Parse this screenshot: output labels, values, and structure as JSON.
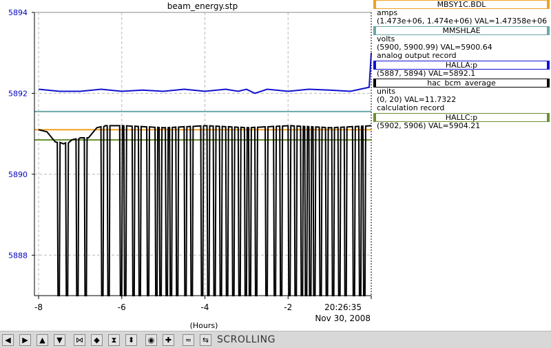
{
  "chart_data": {
    "type": "line",
    "title": "beam_energy.stp",
    "xlabel": "(Hours)",
    "xlim": [
      -8.1,
      0
    ],
    "ylim": [
      5887,
      5894
    ],
    "x_ticks": [
      -8,
      -6,
      -4,
      -2
    ],
    "y_ticks": [
      5888,
      5890,
      5892,
      5894
    ],
    "time_label": "20:26:35",
    "date_label": "Nov 30, 2008",
    "grid": true,
    "legend_position": "right",
    "series": [
      {
        "name": "HALLA:p",
        "color": "#1010d0",
        "x": [
          -8.0,
          -7.5,
          -7.0,
          -6.5,
          -6.0,
          -5.5,
          -5.0,
          -4.5,
          -4.0,
          -3.5,
          -3.2,
          -3.0,
          -2.8,
          -2.5,
          -2.0,
          -1.5,
          -1.0,
          -0.5,
          -0.05,
          0.0
        ],
        "y": [
          5892.1,
          5892.05,
          5892.05,
          5892.1,
          5892.05,
          5892.08,
          5892.05,
          5892.1,
          5892.05,
          5892.1,
          5892.05,
          5892.1,
          5892.0,
          5892.1,
          5892.05,
          5892.1,
          5892.08,
          5892.05,
          5892.15,
          5893.0
        ]
      },
      {
        "name": "MMSHLAE",
        "color": "#6ba7a7",
        "x": [
          -8.1,
          0.0
        ],
        "y": [
          5891.55,
          5891.55
        ]
      },
      {
        "name": "MBSY1C.BDL",
        "color": "#f0a020",
        "x": [
          -8.1,
          0.0
        ],
        "y": [
          5891.1,
          5891.1
        ]
      },
      {
        "name": "HALLC:p",
        "color": "#6a9030",
        "x": [
          -8.1,
          0.0
        ],
        "y": [
          5890.85,
          5890.85
        ]
      },
      {
        "name": "hac_bcm_average",
        "color": "#000000",
        "x": [
          -8.0,
          -7.8,
          -7.6,
          -7.4,
          -7.2,
          -7.0,
          -6.8,
          -6.6,
          -6.4,
          -6.0,
          -5.0,
          -4.0,
          -3.0,
          -2.0,
          -1.0,
          0.0
        ],
        "y": [
          5891.1,
          5891.05,
          5890.8,
          5890.75,
          5890.85,
          5890.9,
          5890.9,
          5891.15,
          5891.2,
          5891.2,
          5891.15,
          5891.2,
          5891.15,
          5891.2,
          5891.15,
          5891.2
        ],
        "dropouts": [
          -7.55,
          -7.35,
          -7.1,
          -6.9,
          -6.5,
          -6.35,
          -6.05,
          -5.95,
          -5.75,
          -5.6,
          -5.4,
          -5.2,
          -5.1,
          -4.95,
          -4.85,
          -4.7,
          -4.5,
          -4.35,
          -4.1,
          -3.95,
          -3.8,
          -3.65,
          -3.5,
          -3.35,
          -3.2,
          -3.05,
          -2.95,
          -2.8,
          -2.55,
          -2.35,
          -2.2,
          -2.0,
          -1.85,
          -1.7,
          -1.6,
          -1.5,
          -1.4,
          -1.25,
          -1.1,
          -0.95,
          -0.8,
          -0.65,
          -0.45,
          -0.3,
          -0.2
        ]
      }
    ]
  },
  "legend": [
    {
      "name": "MBSY1C.BDL",
      "color": "#f0a020",
      "units": "amps",
      "range": "(1.473e+06, 1.474e+06)  VAL=1.47358e+06",
      "record": ""
    },
    {
      "name": "MMSHLAE",
      "color": "#6ba7a7",
      "units": "volts",
      "range": "(5900, 5900.99)  VAL=5900.64",
      "record": "analog output record"
    },
    {
      "name": "HALLA:p",
      "color": "#1010d0",
      "units": "",
      "range": "(5887, 5894) VAL=5892.1",
      "record": ""
    },
    {
      "name": "hac_bcm_average",
      "color": "#000000",
      "units": "units",
      "range": "(0, 20) VAL=11.7322",
      "record": "calculation record"
    },
    {
      "name": "HALLC:p",
      "color": "#6a9030",
      "units": "",
      "range": "(5902, 5906) VAL=5904.21",
      "record": ""
    }
  ],
  "toolbar": {
    "icons": [
      "pan-left-icon",
      "pan-right-icon",
      "pan-up-icon",
      "pan-down-icon",
      "zoom-in-x-icon",
      "zoom-out-x-icon",
      "zoom-in-y-icon",
      "zoom-out-y-icon",
      "reset-icon",
      "add-icon",
      "auto-scale-icon",
      "scroll-mode-icon"
    ],
    "status": "SCROLLING"
  }
}
